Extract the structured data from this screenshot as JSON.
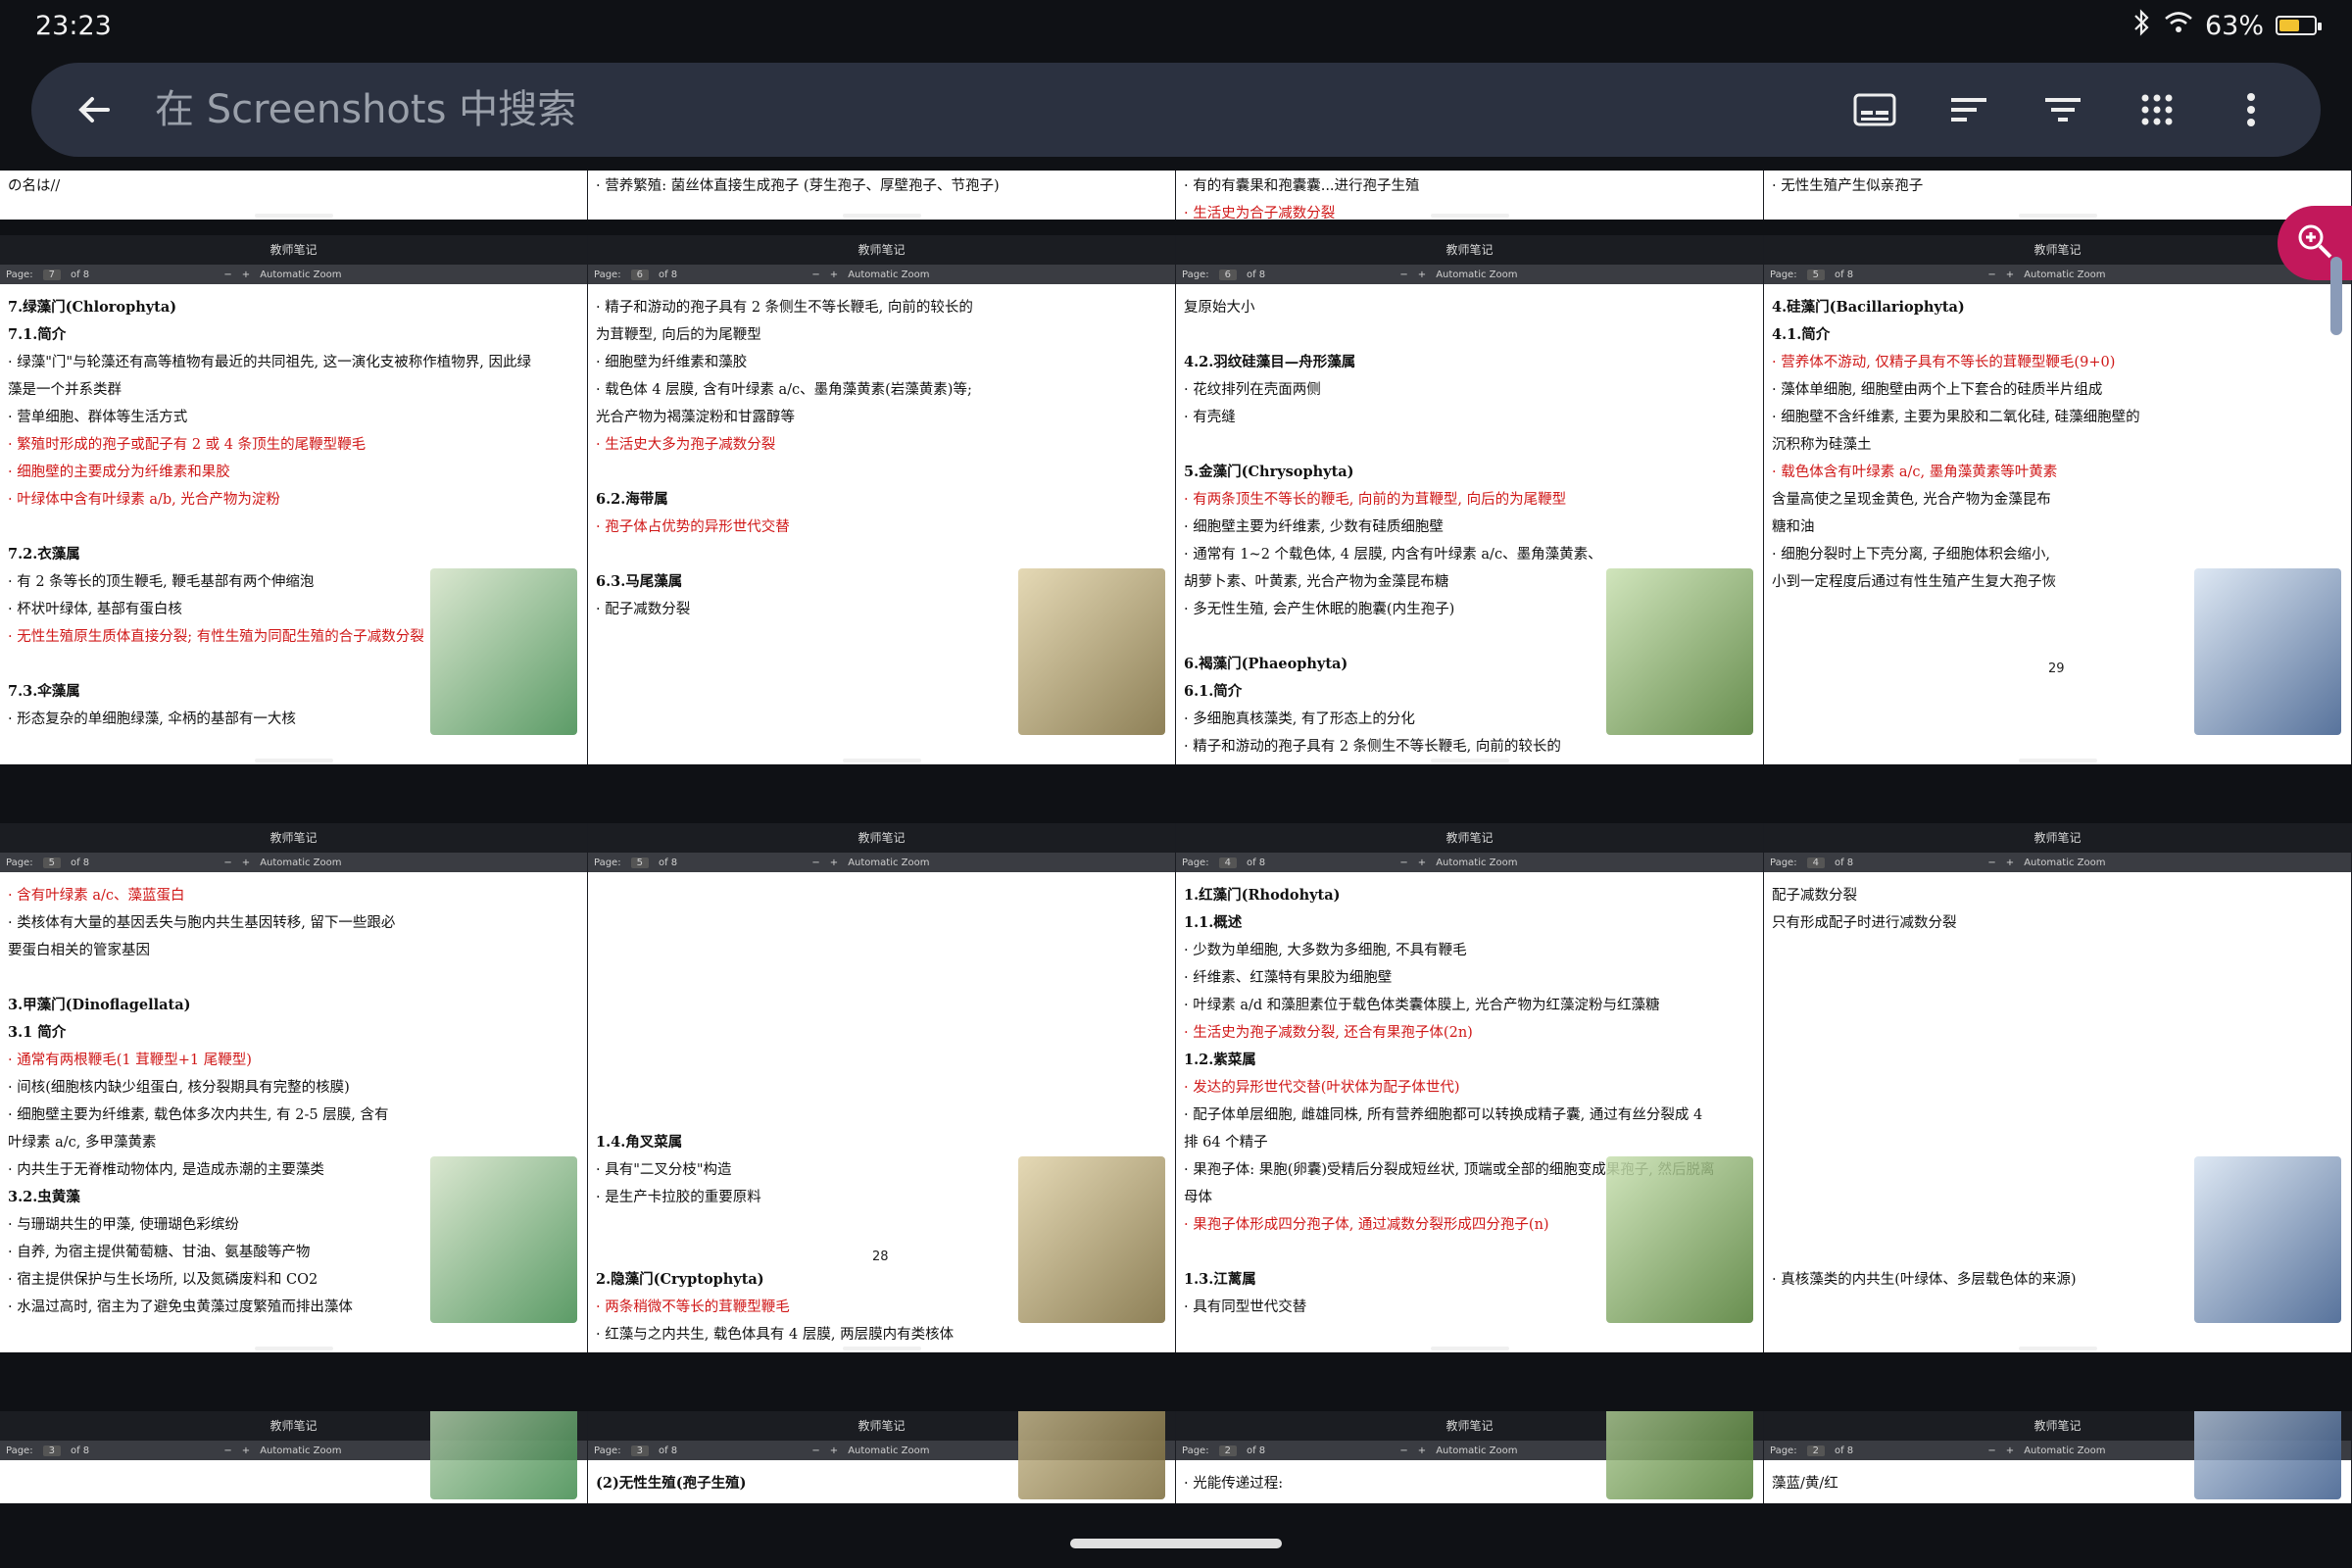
{
  "status": {
    "time": "23:23",
    "battery": "63%",
    "battery_level": 0.63
  },
  "search": {
    "placeholder": "在 Screenshots 中搜索"
  },
  "icons": {
    "back": "back-arrow-icon",
    "toolbar": [
      "subtitles-icon",
      "sort-icon",
      "filter-icon",
      "grid-view-icon",
      "more-vert-icon"
    ],
    "zoom": "zoom-in-icon"
  },
  "header_label": "教师笔记",
  "row0": [
    {
      "lines": [
        "の名は//"
      ]
    },
    {
      "lines": [
        "· 营养繁殖: 菌丝体直接生成孢子 (芽生孢子、厚壁孢子、节孢子)"
      ]
    },
    {
      "lines": [
        "· 有的有囊果和孢囊囊...进行孢子生殖",
        "· 生活史为合子减数分裂"
      ]
    },
    {
      "lines": [
        "· 无性生殖产生似亲孢子"
      ]
    }
  ],
  "row1": [
    {
      "page": "7",
      "of": "of 8",
      "zoom": "Automatic Zoom",
      "lines": [
        "7.绿藻门(Chlorophyta)",
        "7.1.简介",
        "· 绿藻\"门\"与轮藻还有高等植物有最近的共同祖先, 这一演化支被称作植物界, 因此绿",
        "藻是一个并系类群",
        "· 营单细胞、群体等生活方式",
        "· 繁殖时形成的孢子或配子有 2 或 4 条顶生的尾鞭型鞭毛",
        "· 细胞壁的主要成分为纤维素和果胶",
        "· 叶绿体中含有叶绿素 a/b, 光合产物为淀粉",
        "",
        "7.2.衣藻属",
        "· 有 2 条等长的顶生鞭毛, 鞭毛基部有两个伸缩泡",
        "· 杯状叶绿体, 基部有蛋白核",
        "· 无性生殖原生质体直接分裂; 有性生殖为同配生殖的合子减数分裂",
        "",
        "7.3.伞藻属",
        "· 形态复杂的单细胞绿藻, 伞柄的基部有一大核"
      ]
    },
    {
      "page": "6",
      "of": "of 8",
      "zoom": "Automatic Zoom",
      "lines": [
        "· 精子和游动的孢子具有 2 条侧生不等长鞭毛, 向前的较长的",
        "为茸鞭型, 向后的为尾鞭型",
        "· 细胞壁为纤维素和藻胶",
        "· 载色体 4 层膜, 含有叶绿素 a/c、墨角藻黄素(岩藻黄素)等;",
        "光合产物为褐藻淀粉和甘露醇等",
        "· 生活史大多为孢子减数分裂",
        "",
        "6.2.海带属",
        "· 孢子体占优势的异形世代交替",
        "",
        "6.3.马尾藻属",
        "· 配子减数分裂"
      ]
    },
    {
      "page": "6",
      "of": "of 8",
      "zoom": "Automatic Zoom",
      "lines": [
        "复原始大小",
        "",
        "4.2.羽纹硅藻目—舟形藻属",
        "· 花纹排列在壳面两侧",
        "· 有壳缝",
        "",
        "5.金藻门(Chrysophyta)",
        "· 有两条顶生不等长的鞭毛, 向前的为茸鞭型, 向后的为尾鞭型",
        "· 细胞壁主要为纤维素, 少数有硅质细胞壁",
        "· 通常有 1~2 个载色体, 4 层膜, 内含有叶绿素 a/c、墨角藻黄素、",
        "胡萝卜素、叶黄素, 光合产物为金藻昆布糖",
        "· 多无性生殖, 会产生休眠的胞囊(内生孢子)",
        "",
        "6.褐藻门(Phaeophyta)",
        "6.1.简介",
        "· 多细胞真核藻类, 有了形态上的分化",
        "· 精子和游动的孢子具有 2 条侧生不等长鞭毛, 向前的较长的"
      ]
    },
    {
      "page": "5",
      "of": "of 8",
      "zoom": "Automatic Zoom",
      "pagenum": "29",
      "lines": [
        "4.硅藻门(Bacillariophyta)",
        "4.1.简介",
        "· 营养体不游动, 仅精子具有不等长的茸鞭型鞭毛(9+0)",
        "· 藻体单细胞, 细胞壁由两个上下套合的硅质半片组成",
        "· 细胞壁不含纤维素, 主要为果胶和二氧化硅, 硅藻细胞壁的",
        "沉积称为硅藻土",
        "· 载色体含有叶绿素 a/c, 墨角藻黄素等叶黄素",
        "含量高使之呈现金黄色, 光合产物为金藻昆布",
        "糖和油",
        "· 细胞分裂时上下壳分离, 子细胞体积会缩小,",
        "小到一定程度后通过有性生殖产生复大孢子恢"
      ]
    }
  ],
  "row2": [
    {
      "page": "5",
      "of": "of 8",
      "zoom": "Automatic Zoom",
      "lines": [
        "· 含有叶绿素 a/c、藻蓝蛋白",
        "· 类核体有大量的基因丢失与胞内共生基因转移, 留下一些跟必",
        "要蛋白相关的管家基因",
        "",
        "3.甲藻门(Dinoflagellata)",
        "3.1 简介",
        "· 通常有两根鞭毛(1 茸鞭型+1 尾鞭型)",
        "· 间核(细胞核内缺少组蛋白, 核分裂期具有完整的核膜)",
        "· 细胞壁主要为纤维素, 载色体多次内共生, 有 2-5 层膜, 含有",
        "叶绿素 a/c, 多甲藻黄素",
        "· 内共生于无脊椎动物体内, 是造成赤潮的主要藻类",
        "3.2.虫黄藻",
        "· 与珊瑚共生的甲藻, 使珊瑚色彩缤纷",
        "· 自养, 为宿主提供葡萄糖、甘油、氨基酸等产物",
        "· 宿主提供保护与生长场所, 以及氮磷废料和 CO2",
        "· 水温过高时, 宿主为了避免虫黄藻过度繁殖而排出藻体",
        "",
        "4.硅藻门(Bacillariophyta)"
      ]
    },
    {
      "page": "5",
      "of": "of 8",
      "zoom": "Automatic Zoom",
      "pagenum": "28",
      "lines": [
        "",
        "",
        "",
        "",
        "",
        "",
        "",
        "",
        "",
        "1.4.角叉菜属",
        "· 具有\"二叉分枝\"构造",
        "· 是生产卡拉胶的重要原料",
        "",
        "",
        "2.隐藻门(Cryptophyta)",
        "· 两条稍微不等长的茸鞭型鞭毛",
        "· 红藻与之内共生, 载色体具有 4 层膜, 两层膜内有类核体"
      ]
    },
    {
      "page": "4",
      "of": "of 8",
      "zoom": "Automatic Zoom",
      "lines": [
        "1.红藻门(Rhodohyta)",
        "1.1.概述",
        "· 少数为单细胞, 大多数为多细胞, 不具有鞭毛",
        "· 纤维素、红藻特有果胶为细胞壁",
        "· 叶绿素 a/d 和藻胆素位于载色体类囊体膜上, 光合产物为红藻淀粉与红藻糖",
        "· 生活史为孢子减数分裂, 还合有果孢子体(2n)",
        "1.2.紫菜属",
        "· 发达的异形世代交替(叶状体为配子体世代)",
        "· 配子体单层细胞, 雌雄同株, 所有营养细胞都可以转换成精子囊, 通过有丝分裂成 4",
        "排 64 个精子",
        "· 果孢子体: 果胞(卵囊)受精后分裂成短丝状, 顶端或全部的细胞变成果孢子, 然后脱离",
        "母体",
        "· 果孢子体形成四分孢子体, 通过减数分裂形成四分孢子(n)",
        "",
        "1.3.江蓠属",
        "· 具有同型世代交替"
      ]
    },
    {
      "page": "4",
      "of": "of 8",
      "zoom": "Automatic Zoom",
      "lines": [
        "配子减数分裂",
        "只有形成配子时进行减数分裂",
        "",
        "",
        "",
        "",
        "",
        "",
        "",
        "",
        "",
        "",
        "",
        "",
        "· 真核藻类的内共生(叶绿体、多层载色体的来源)"
      ]
    }
  ],
  "row3": [
    {
      "page": "3",
      "of": "of 8",
      "zoom": "Automatic Zoom",
      "lines": [
        ""
      ]
    },
    {
      "page": "3",
      "of": "of 8",
      "zoom": "Automatic Zoom",
      "lines": [
        "(2)无性生殖(孢子生殖)"
      ]
    },
    {
      "page": "2",
      "of": "of 8",
      "zoom": "Automatic Zoom",
      "lines": [
        "· 光能传递过程:"
      ]
    },
    {
      "page": "2",
      "of": "of 8",
      "zoom": "Automatic Zoom",
      "lines": [
        "藻蓝/黄/红"
      ]
    }
  ]
}
